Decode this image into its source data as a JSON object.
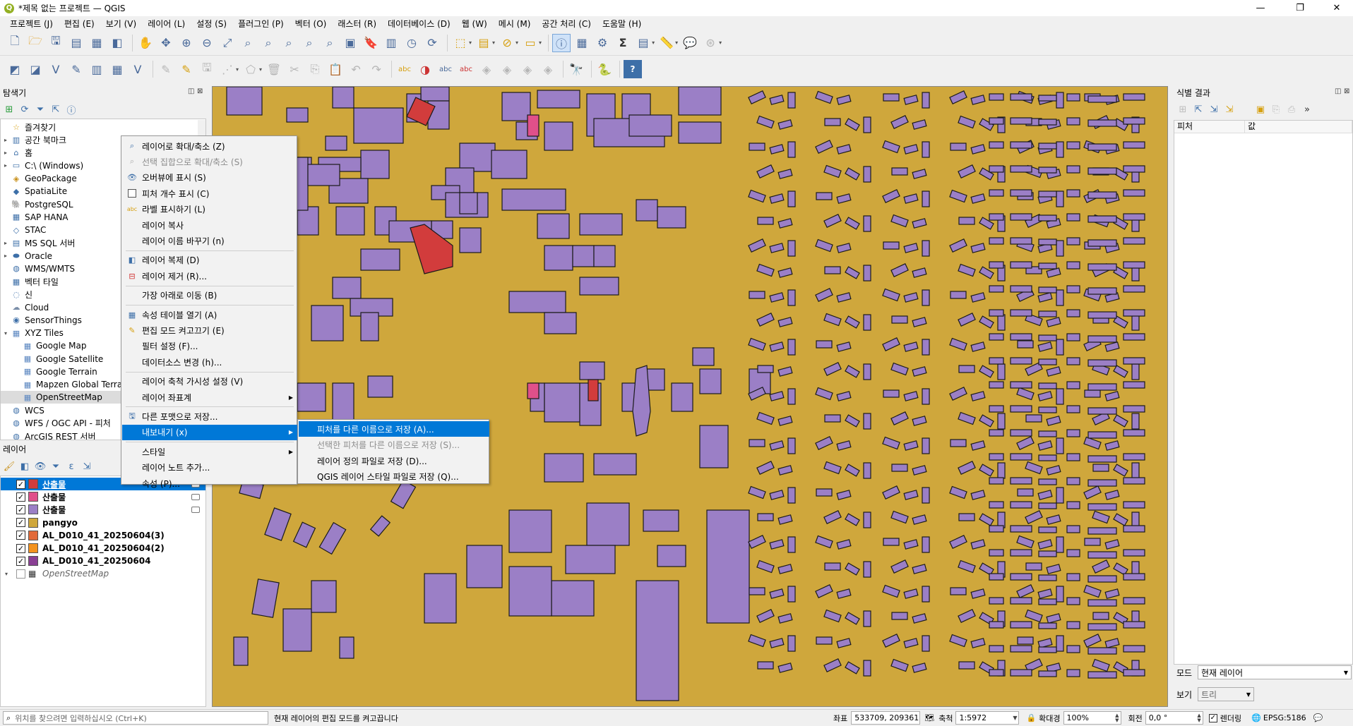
{
  "window": {
    "title": "*제목 없는 프로젝트 — QGIS",
    "min": "—",
    "max": "❐",
    "close": "✕"
  },
  "menubar": [
    "프로젝트 (J)",
    "편집 (E)",
    "보기 (V)",
    "레이어 (L)",
    "설정 (S)",
    "플러그인 (P)",
    "벡터 (O)",
    "래스터 (R)",
    "데이터베이스 (D)",
    "웹 (W)",
    "메시 (M)",
    "공간 처리 (C)",
    "도움말 (H)"
  ],
  "browser": {
    "title": "탐색기",
    "items": [
      {
        "label": "즐겨찾기",
        "icon": "star-icon",
        "arrow": ""
      },
      {
        "label": "공간 북마크",
        "icon": "bookmark-icon",
        "arrow": "▸"
      },
      {
        "label": "홈",
        "icon": "home-folder-icon",
        "arrow": "▸"
      },
      {
        "label": "C:\\ (Windows)",
        "icon": "drive-icon",
        "arrow": "▸"
      },
      {
        "label": "GeoPackage",
        "icon": "geopackage-icon",
        "arrow": ""
      },
      {
        "label": "SpatiaLite",
        "icon": "spatialite-icon",
        "arrow": ""
      },
      {
        "label": "PostgreSQL",
        "icon": "postgresql-icon",
        "arrow": ""
      },
      {
        "label": "SAP HANA",
        "icon": "sap-hana-icon",
        "arrow": ""
      },
      {
        "label": "STAC",
        "icon": "stac-icon",
        "arrow": ""
      },
      {
        "label": "MS SQL 서버",
        "icon": "mssql-icon",
        "arrow": "▸"
      },
      {
        "label": "Oracle",
        "icon": "oracle-icon",
        "arrow": "▸"
      },
      {
        "label": "WMS/WMTS",
        "icon": "wms-icon",
        "arrow": ""
      },
      {
        "label": "벡터 타일",
        "icon": "vector-tile-icon",
        "arrow": ""
      },
      {
        "label": "신",
        "icon": "scene-icon",
        "arrow": ""
      },
      {
        "label": "Cloud",
        "icon": "cloud-icon",
        "arrow": ""
      },
      {
        "label": "SensorThings",
        "icon": "sensorthings-icon",
        "arrow": ""
      },
      {
        "label": "XYZ Tiles",
        "icon": "xyz-tiles-icon",
        "arrow": "▾"
      },
      {
        "label": "Google Map",
        "icon": "tile-grid-icon",
        "arrow": "",
        "indent": true
      },
      {
        "label": "Google Satellite",
        "icon": "tile-grid-icon",
        "arrow": "",
        "indent": true
      },
      {
        "label": "Google Terrain",
        "icon": "tile-grid-icon",
        "arrow": "",
        "indent": true
      },
      {
        "label": "Mapzen Global Terrai",
        "icon": "tile-grid-icon",
        "arrow": "",
        "indent": true
      },
      {
        "label": "OpenStreetMap",
        "icon": "tile-grid-icon",
        "arrow": "",
        "indent": true,
        "selected": true
      },
      {
        "label": "WCS",
        "icon": "wcs-icon",
        "arrow": ""
      },
      {
        "label": "WFS / OGC API - 피처",
        "icon": "wfs-icon",
        "arrow": ""
      },
      {
        "label": "ArcGIS REST 서버",
        "icon": "arcgis-icon",
        "arrow": ""
      }
    ]
  },
  "layers": {
    "title": "레이어",
    "items": [
      {
        "label": "산출물",
        "color": "#d23c3c",
        "checked": true,
        "selected": true
      },
      {
        "label": "산출물",
        "color": "#e0508a",
        "checked": true
      },
      {
        "label": "산출물",
        "color": "#9b7fc6",
        "checked": true
      },
      {
        "label": "pangyo",
        "color": "#cfa73c",
        "checked": true
      },
      {
        "label": "AL_D010_41_20250604(3)",
        "color": "#e26a3a",
        "checked": true
      },
      {
        "label": "AL_D010_41_20250604(2)",
        "color": "#f4931e",
        "checked": true
      },
      {
        "label": "AL_D010_41_20250604",
        "color": "#8a3f94",
        "checked": true
      },
      {
        "label": "OpenStreetMap",
        "color": "",
        "checked": false,
        "italic": true
      }
    ]
  },
  "context_menu": [
    {
      "label": "레이어로 확대/축소 (Z)",
      "icon": "zoom-layer-icon"
    },
    {
      "label": "선택 집합으로 확대/축소 (S)",
      "icon": "zoom-selection-icon",
      "disabled": true
    },
    {
      "label": "오버뷰에 표시 (S)",
      "icon": "overview-icon"
    },
    {
      "label": "피처 개수 표시 (C)",
      "checkbox": true
    },
    {
      "label": "라벨 표시하기 (L)",
      "icon": "label-icon"
    },
    {
      "label": "레이어 복사"
    },
    {
      "label": "레이어 이름 바꾸기 (n)"
    },
    {
      "sep": true
    },
    {
      "label": "레이어 복제 (D)",
      "icon": "duplicate-icon"
    },
    {
      "label": "레이어 제거 (R)...",
      "icon": "remove-layer-icon"
    },
    {
      "sep": true
    },
    {
      "label": "가장 아래로 이동 (B)"
    },
    {
      "sep": true
    },
    {
      "label": "속성 테이블 열기 (A)",
      "icon": "table-icon"
    },
    {
      "label": "편집 모드 켜고끄기 (E)",
      "icon": "pencil-icon"
    },
    {
      "label": "필터 설정 (F)..."
    },
    {
      "label": "데이터소스 변경 (h)..."
    },
    {
      "sep": true
    },
    {
      "label": "레이어 축척 가시성 설정 (V)"
    },
    {
      "label": "레이어 좌표계",
      "submenu": true
    },
    {
      "sep": true
    },
    {
      "label": "다른 포맷으로 저장...",
      "icon": "save-as-icon"
    },
    {
      "label": "내보내기 (x)",
      "submenu": true,
      "highlight": true
    },
    {
      "sep": true
    },
    {
      "label": "스타일",
      "submenu": true
    },
    {
      "label": "레이어 노트 추가..."
    },
    {
      "label": "속성 (P)..."
    }
  ],
  "export_submenu": [
    {
      "label": "피처를 다른 이름으로 저장 (A)...",
      "highlight": true
    },
    {
      "label": "선택한 피처를 다른 이름으로 저장 (S)...",
      "disabled": true
    },
    {
      "label": "레이어 정의 파일로 저장 (D)..."
    },
    {
      "label": "QGIS 레이어 스타일 파일로 저장 (Q)..."
    }
  ],
  "identify": {
    "title": "식별 결과",
    "col_feature": "피처",
    "col_value": "값",
    "mode_label": "모드",
    "mode_value": "현재 레이어",
    "view_label": "보기",
    "view_value": "트리"
  },
  "status": {
    "locator_placeholder": "위치를 찾으려면 입력하십시오 (Ctrl+K)",
    "message": "현재 레이어의 편집 모드를 켜고끕니다",
    "coord_label": "좌표",
    "coord_value": "533709, 209361",
    "scale_label": "축척",
    "scale_value": "1:5972",
    "magnifier_label": "확대경",
    "magnifier_value": "100%",
    "rotation_label": "회전",
    "rotation_value": "0,0 °",
    "render_label": "렌더링",
    "crs_value": "EPSG:5186"
  },
  "colors": {
    "map_bg": "#cfa73c",
    "building": "#9b7fc6",
    "red": "#d23c3c",
    "pink": "#e0508a",
    "accent": "#0078d7"
  }
}
